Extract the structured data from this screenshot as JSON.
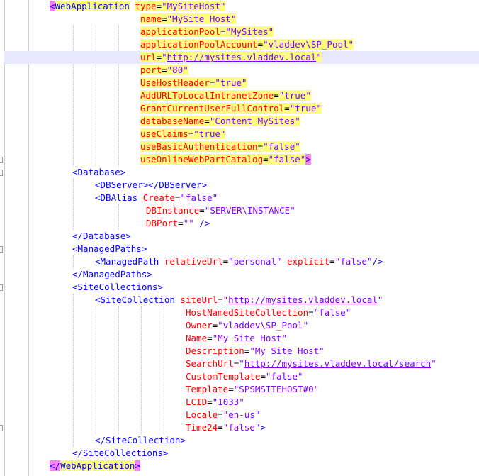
{
  "lines": [
    [
      {
        "t": "<",
        "c": "tag bracket"
      },
      {
        "t": "WebApplication",
        "c": "tag hl"
      },
      {
        "t": " ",
        "c": "txt"
      },
      {
        "t": "type",
        "c": "attr hl"
      },
      {
        "t": "=",
        "c": "txt hl"
      },
      {
        "t": "\"MySiteHost\"",
        "c": "val hl"
      }
    ],
    [
      {
        "t": "name",
        "c": "attr hl"
      },
      {
        "t": "=",
        "c": "txt hl"
      },
      {
        "t": "\"MySite Host\"",
        "c": "val hl"
      }
    ],
    [
      {
        "t": "applicationPool",
        "c": "attr hl"
      },
      {
        "t": "=",
        "c": "txt hl"
      },
      {
        "t": "\"MySites\"",
        "c": "val hl"
      }
    ],
    [
      {
        "t": "applicationPoolAccount",
        "c": "attr hl"
      },
      {
        "t": "=",
        "c": "txt hl"
      },
      {
        "t": "\"vladdev\\SP_Pool\"",
        "c": "val hl"
      }
    ],
    [
      {
        "t": "url",
        "c": "attr hl"
      },
      {
        "t": "=",
        "c": "txt hl"
      },
      {
        "t": "\"",
        "c": "val hl"
      },
      {
        "t": "http://mysites.vladdev.local",
        "c": "url hl"
      },
      {
        "t": "\"",
        "c": "val hl"
      }
    ],
    [
      {
        "t": "port",
        "c": "attr hl"
      },
      {
        "t": "=",
        "c": "txt hl"
      },
      {
        "t": "\"80\"",
        "c": "val hl"
      }
    ],
    [
      {
        "t": "UseHostHeader",
        "c": "attr hl"
      },
      {
        "t": "=",
        "c": "txt hl"
      },
      {
        "t": "\"true\"",
        "c": "val hl"
      }
    ],
    [
      {
        "t": "AddURLToLocalIntranetZone",
        "c": "attr hl"
      },
      {
        "t": "=",
        "c": "txt hl"
      },
      {
        "t": "\"true\"",
        "c": "val hl"
      }
    ],
    [
      {
        "t": "GrantCurrentUserFullControl",
        "c": "attr hl"
      },
      {
        "t": "=",
        "c": "txt hl"
      },
      {
        "t": "\"true\"",
        "c": "val hl"
      }
    ],
    [
      {
        "t": "databaseName",
        "c": "attr hl"
      },
      {
        "t": "=",
        "c": "txt hl"
      },
      {
        "t": "\"Content_MySites\"",
        "c": "val hl"
      }
    ],
    [
      {
        "t": "useClaims",
        "c": "attr hl"
      },
      {
        "t": "=",
        "c": "txt hl"
      },
      {
        "t": "\"true\"",
        "c": "val hl"
      }
    ],
    [
      {
        "t": "useBasicAuthentication",
        "c": "attr hl"
      },
      {
        "t": "=",
        "c": "txt hl"
      },
      {
        "t": "\"false\"",
        "c": "val hl"
      }
    ],
    [
      {
        "t": "useOnlineWebPartCatalog",
        "c": "attr hl"
      },
      {
        "t": "=",
        "c": "txt hl"
      },
      {
        "t": "\"false\"",
        "c": "val hl"
      },
      {
        "t": ">",
        "c": "tag bracket"
      }
    ],
    [
      {
        "t": "<Database>",
        "c": "tag"
      }
    ],
    [
      {
        "t": "<DBServer></DBServer>",
        "c": "tag"
      }
    ],
    [
      {
        "t": "<DBAlias",
        "c": "tag"
      },
      {
        "t": " ",
        "c": "txt"
      },
      {
        "t": "Create",
        "c": "attr"
      },
      {
        "t": "=",
        "c": "txt"
      },
      {
        "t": "\"false\"",
        "c": "val"
      }
    ],
    [
      {
        "t": "DBInstance",
        "c": "attr"
      },
      {
        "t": "=",
        "c": "txt"
      },
      {
        "t": "\"SERVER\\INSTANCE\"",
        "c": "val"
      }
    ],
    [
      {
        "t": "DBPort",
        "c": "attr"
      },
      {
        "t": "=",
        "c": "txt"
      },
      {
        "t": "\"\"",
        "c": "val"
      },
      {
        "t": " />",
        "c": "tag"
      }
    ],
    [
      {
        "t": "</Database>",
        "c": "tag"
      }
    ],
    [
      {
        "t": "<ManagedPaths>",
        "c": "tag"
      }
    ],
    [
      {
        "t": "<ManagedPath",
        "c": "tag"
      },
      {
        "t": " ",
        "c": "txt"
      },
      {
        "t": "relativeUrl",
        "c": "attr"
      },
      {
        "t": "=",
        "c": "txt"
      },
      {
        "t": "\"personal\"",
        "c": "val"
      },
      {
        "t": " ",
        "c": "txt"
      },
      {
        "t": "explicit",
        "c": "attr"
      },
      {
        "t": "=",
        "c": "txt"
      },
      {
        "t": "\"false\"",
        "c": "val"
      },
      {
        "t": "/>",
        "c": "tag"
      }
    ],
    [
      {
        "t": "</ManagedPaths>",
        "c": "tag"
      }
    ],
    [
      {
        "t": "<SiteCollections>",
        "c": "tag"
      }
    ],
    [
      {
        "t": "<SiteCollection",
        "c": "tag"
      },
      {
        "t": " ",
        "c": "txt"
      },
      {
        "t": "siteUrl",
        "c": "attr"
      },
      {
        "t": "=",
        "c": "txt"
      },
      {
        "t": "\"",
        "c": "val"
      },
      {
        "t": "http://mysites.vladdev.local",
        "c": "url"
      },
      {
        "t": "\"",
        "c": "val"
      }
    ],
    [
      {
        "t": "HostNamedSiteCollection",
        "c": "attr"
      },
      {
        "t": "=",
        "c": "txt"
      },
      {
        "t": "\"false\"",
        "c": "val"
      }
    ],
    [
      {
        "t": "Owner",
        "c": "attr"
      },
      {
        "t": "=",
        "c": "txt"
      },
      {
        "t": "\"vladdev\\SP_Pool\"",
        "c": "val"
      }
    ],
    [
      {
        "t": "Name",
        "c": "attr"
      },
      {
        "t": "=",
        "c": "txt"
      },
      {
        "t": "\"My Site Host\"",
        "c": "val"
      }
    ],
    [
      {
        "t": "Description",
        "c": "attr"
      },
      {
        "t": "=",
        "c": "txt"
      },
      {
        "t": "\"My Site Host\"",
        "c": "val"
      }
    ],
    [
      {
        "t": "SearchUrl",
        "c": "attr"
      },
      {
        "t": "=",
        "c": "txt"
      },
      {
        "t": "\"",
        "c": "val"
      },
      {
        "t": "http://mysites.vladdev.local/search",
        "c": "url"
      },
      {
        "t": "\"",
        "c": "val"
      }
    ],
    [
      {
        "t": "CustomTemplate",
        "c": "attr"
      },
      {
        "t": "=",
        "c": "txt"
      },
      {
        "t": "\"false\"",
        "c": "val"
      }
    ],
    [
      {
        "t": "Template",
        "c": "attr"
      },
      {
        "t": "=",
        "c": "txt"
      },
      {
        "t": "\"SPSMSITEHOST#0\"",
        "c": "val"
      }
    ],
    [
      {
        "t": "LCID",
        "c": "attr"
      },
      {
        "t": "=",
        "c": "txt"
      },
      {
        "t": "\"1033\"",
        "c": "val"
      }
    ],
    [
      {
        "t": "Locale",
        "c": "attr"
      },
      {
        "t": "=",
        "c": "txt"
      },
      {
        "t": "\"en-us\"",
        "c": "val"
      }
    ],
    [
      {
        "t": "Time24",
        "c": "attr"
      },
      {
        "t": "=",
        "c": "txt"
      },
      {
        "t": "\"false\"",
        "c": "val"
      },
      {
        "t": ">",
        "c": "tag"
      }
    ],
    [
      {
        "t": "</SiteCollection>",
        "c": "tag"
      }
    ],
    [
      {
        "t": "</SiteCollections>",
        "c": "tag"
      }
    ],
    [
      {
        "t": "</",
        "c": "tag bracket"
      },
      {
        "t": "WebApplication",
        "c": "tag hl"
      },
      {
        "t": ">",
        "c": "tag bracket"
      }
    ]
  ]
}
